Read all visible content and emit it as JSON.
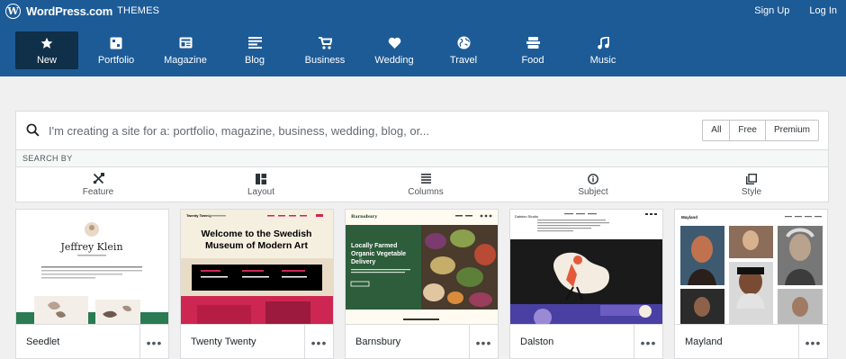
{
  "masterbar": {
    "brand": "WordPress.com",
    "section": "THEMES",
    "signup": "Sign Up",
    "login": "Log In"
  },
  "categories": [
    {
      "label": "New",
      "icon": "star-icon",
      "active": true
    },
    {
      "label": "Portfolio",
      "icon": "portfolio-icon"
    },
    {
      "label": "Magazine",
      "icon": "magazine-icon"
    },
    {
      "label": "Blog",
      "icon": "blog-icon"
    },
    {
      "label": "Business",
      "icon": "cart-icon"
    },
    {
      "label": "Wedding",
      "icon": "heart-icon"
    },
    {
      "label": "Travel",
      "icon": "globe-icon"
    },
    {
      "label": "Food",
      "icon": "food-icon"
    },
    {
      "label": "Music",
      "icon": "music-icon"
    }
  ],
  "search": {
    "placeholder": "I'm creating a site for a: portfolio, magazine, business, wedding, blog, or...",
    "tiers": [
      "All",
      "Free",
      "Premium"
    ]
  },
  "searchby": {
    "title": "SEARCH BY",
    "filters": [
      "Feature",
      "Layout",
      "Columns",
      "Subject",
      "Style"
    ]
  },
  "themes": [
    {
      "name": "Seedlet",
      "preview_title": "Jeffrey Klein"
    },
    {
      "name": "Twenty Twenty",
      "preview_title": "Welcome to the Swedish Museum of Modern Art",
      "preview_site": "Twenty Twenty"
    },
    {
      "name": "Barnsbury",
      "preview_title": "Locally Farmed Organic Vegetable Delivery",
      "preview_site": "Barnsbury"
    },
    {
      "name": "Dalston",
      "preview_site": "Dalston Studio"
    },
    {
      "name": "Mayland",
      "preview_site": "Mayland"
    }
  ],
  "colors": {
    "brand": "#1d5b97",
    "active_tab": "#102f49"
  }
}
